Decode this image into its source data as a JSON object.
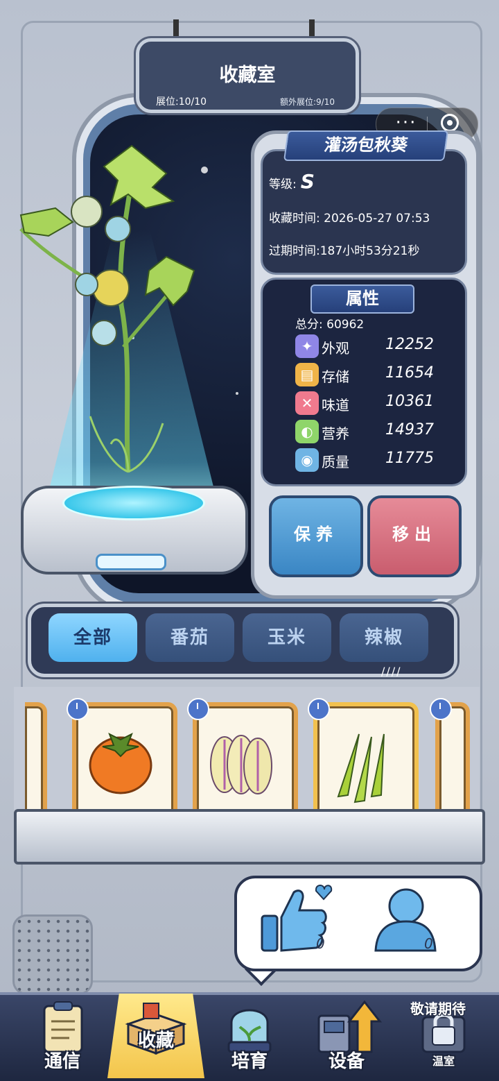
{
  "header": {
    "title": "收藏室",
    "slots": "展位:10/10",
    "extra_slots": "额外展位:9/10"
  },
  "capsule": {
    "more_icon": "···",
    "close_icon": "target-icon"
  },
  "plant_info": {
    "name": "灌汤包秋葵",
    "grade_label": "等级:",
    "grade_value": "S",
    "collect_time": "收藏时间: 2026-05-27 07:53",
    "expire_time": "过期时间:187小时53分21秒"
  },
  "attributes": {
    "title": "属性",
    "total": "总分: 60962",
    "items": [
      {
        "name": "外观",
        "value": "12252",
        "icon": "sparkle-icon",
        "color": "#8f86e6"
      },
      {
        "name": "存储",
        "value": "11654",
        "icon": "storage-icon",
        "color": "#f0b448"
      },
      {
        "name": "味道",
        "value": "10361",
        "icon": "utensils-icon",
        "color": "#f07a8e"
      },
      {
        "name": "营养",
        "value": "14937",
        "icon": "lemon-icon",
        "color": "#8fd56a"
      },
      {
        "name": "质量",
        "value": "11775",
        "icon": "muscle-icon",
        "color": "#6fb4e4"
      }
    ]
  },
  "actions": {
    "maintain": "保养",
    "remove": "移出"
  },
  "filter_tabs": [
    {
      "label": "全部",
      "active": true
    },
    {
      "label": "番茄",
      "active": false
    },
    {
      "label": "玉米",
      "active": false
    },
    {
      "label": "辣椒",
      "active": false
    }
  ],
  "collection_cards": [
    {
      "item": "partial-card-left"
    },
    {
      "item": "persimmon"
    },
    {
      "item": "striped-melon"
    },
    {
      "item": "okra",
      "selected": true
    },
    {
      "item": "partial-card-right"
    }
  ],
  "social": {
    "likes": "0",
    "visitors": "0"
  },
  "bottom_nav": [
    {
      "label": "通信"
    },
    {
      "label": "收藏",
      "active": true
    },
    {
      "label": "培育"
    },
    {
      "label": "设备"
    },
    {
      "label": "温室",
      "badge": "敬请期待"
    }
  ]
}
